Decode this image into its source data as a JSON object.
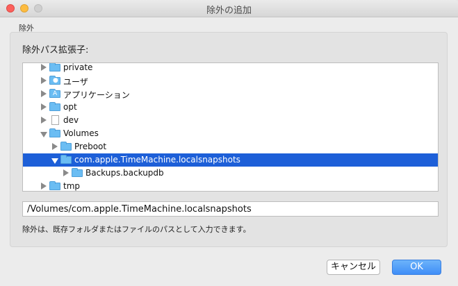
{
  "window": {
    "title": "除外の追加"
  },
  "group": {
    "label": "除外"
  },
  "section": {
    "label": "除外パス拡張子:"
  },
  "tree": {
    "items": [
      {
        "label": "private",
        "icon": "folder-icon",
        "disclosure": "collapsed"
      },
      {
        "label": "ユーザ",
        "icon": "users-folder-icon",
        "disclosure": "collapsed"
      },
      {
        "label": "アプリケーション",
        "icon": "applications-folder-icon",
        "disclosure": "collapsed"
      },
      {
        "label": "opt",
        "icon": "folder-icon",
        "disclosure": "collapsed"
      },
      {
        "label": "dev",
        "icon": "document-icon",
        "disclosure": "collapsed"
      },
      {
        "label": "Volumes",
        "icon": "folder-icon",
        "disclosure": "expanded"
      },
      {
        "label": "Preboot",
        "icon": "folder-icon",
        "disclosure": "collapsed"
      },
      {
        "label": "com.apple.TimeMachine.localsnapshots",
        "icon": "folder-icon",
        "disclosure": "expanded",
        "selected": true
      },
      {
        "label": "Backups.backupdb",
        "icon": "folder-icon",
        "disclosure": "collapsed"
      },
      {
        "label": "tmp",
        "icon": "folder-icon",
        "disclosure": "collapsed"
      }
    ]
  },
  "path_field": {
    "value": "/Volumes/com.apple.TimeMachine.localsnapshots"
  },
  "help_text": "除外は、既存フォルダまたはファイルのパスとして入力できます。",
  "buttons": {
    "cancel": "キャンセル",
    "ok": "OK"
  },
  "colors": {
    "selection": "#1d5fd8",
    "folder": "#6bbdf3",
    "ok_button": "#3f8ef7"
  }
}
